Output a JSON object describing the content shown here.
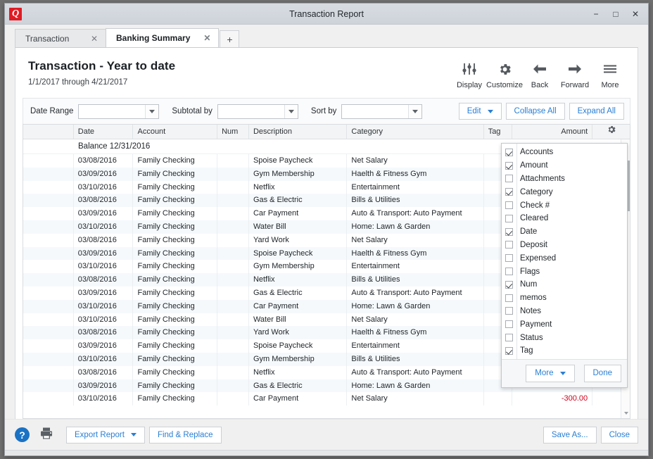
{
  "window": {
    "title": "Transaction Report",
    "app_logo": "Q",
    "minimize": "−",
    "maximize": "□",
    "close": "✕"
  },
  "tabs": [
    {
      "label": "Transaction",
      "close": "✕",
      "active": false
    },
    {
      "label": "Banking Summary",
      "close": "✕",
      "active": true
    }
  ],
  "tab_add_label": "+",
  "report": {
    "title": "Transaction - Year to date",
    "subtitle": "1/1/2017 through 4/21/2017"
  },
  "toolbar": [
    {
      "label": "Display",
      "icon": "sliders-icon"
    },
    {
      "label": "Customize",
      "icon": "gear-icon"
    },
    {
      "label": "Back",
      "icon": "arrow-left-icon"
    },
    {
      "label": "Forward",
      "icon": "arrow-right-icon"
    },
    {
      "label": "More",
      "icon": "hamburger-icon"
    }
  ],
  "filterbar": {
    "date_range_label": "Date Range",
    "date_range_value": "",
    "subtotal_label": "Subtotal by",
    "subtotal_value": "",
    "sort_label": "Sort by",
    "sort_value": "",
    "edit_label": "Edit",
    "collapse_all_label": "Collapse All",
    "expand_all_label": "Expand All"
  },
  "table": {
    "columns": [
      "",
      "Date",
      "Account",
      "Num",
      "Description",
      "Category",
      "Tag",
      "Amount",
      ""
    ],
    "gear_icon": "gear-icon",
    "balance_row_label": "Balance 12/31/2016",
    "rows": [
      {
        "date": "03/08/2016",
        "account": "Family Checking",
        "num": "",
        "description": "Spoise Paycheck",
        "category": "Net Salary",
        "tag": "",
        "amount": ""
      },
      {
        "date": "03/09/2016",
        "account": "Family Checking",
        "num": "",
        "description": "Gym Membership",
        "category": "Haelth & Fitness Gym",
        "tag": "",
        "amount": ""
      },
      {
        "date": "03/10/2016",
        "account": "Family Checking",
        "num": "",
        "description": "Netflix",
        "category": "Entertainment",
        "tag": "",
        "amount": ""
      },
      {
        "date": "03/08/2016",
        "account": "Family Checking",
        "num": "",
        "description": "Gas & Electric",
        "category": "Bills & Utilities",
        "tag": "",
        "amount": ""
      },
      {
        "date": "03/09/2016",
        "account": "Family Checking",
        "num": "",
        "description": "Car Payment",
        "category": "Auto & Transport: Auto Payment",
        "tag": "",
        "amount": ""
      },
      {
        "date": "03/10/2016",
        "account": "Family Checking",
        "num": "",
        "description": "Water Bill",
        "category": "Home: Lawn & Garden",
        "tag": "",
        "amount": ""
      },
      {
        "date": "03/08/2016",
        "account": "Family Checking",
        "num": "",
        "description": "Yard Work",
        "category": "Net Salary",
        "tag": "",
        "amount": ""
      },
      {
        "date": "03/09/2016",
        "account": "Family Checking",
        "num": "",
        "description": "Spoise Paycheck",
        "category": "Haelth & Fitness Gym",
        "tag": "",
        "amount": ""
      },
      {
        "date": "03/10/2016",
        "account": "Family Checking",
        "num": "",
        "description": "Gym Membership",
        "category": "Entertainment",
        "tag": "",
        "amount": ""
      },
      {
        "date": "03/08/2016",
        "account": "Family Checking",
        "num": "",
        "description": "Netflix",
        "category": "Bills & Utilities",
        "tag": "",
        "amount": ""
      },
      {
        "date": "03/09/2016",
        "account": "Family Checking",
        "num": "",
        "description": "Gas & Electric",
        "category": "Auto & Transport: Auto Payment",
        "tag": "",
        "amount": ""
      },
      {
        "date": "03/10/2016",
        "account": "Family Checking",
        "num": "",
        "description": "Car Payment",
        "category": "Home: Lawn & Garden",
        "tag": "",
        "amount": ""
      },
      {
        "date": "03/10/2016",
        "account": "Family Checking",
        "num": "",
        "description": "Water Bill",
        "category": "Net Salary",
        "tag": "",
        "amount": ""
      },
      {
        "date": "03/08/2016",
        "account": "Family Checking",
        "num": "",
        "description": "Yard Work",
        "category": "Haelth & Fitness Gym",
        "tag": "",
        "amount": ""
      },
      {
        "date": "03/09/2016",
        "account": "Family Checking",
        "num": "",
        "description": "Spoise Paycheck",
        "category": "Entertainment",
        "tag": "",
        "amount": ""
      },
      {
        "date": "03/10/2016",
        "account": "Family Checking",
        "num": "",
        "description": "Gym Membership",
        "category": "Bills & Utilities",
        "tag": "",
        "amount": ""
      },
      {
        "date": "03/08/2016",
        "account": "Family Checking",
        "num": "",
        "description": "Netflix",
        "category": "Auto & Transport: Auto Payment",
        "tag": "",
        "amount": ""
      },
      {
        "date": "03/09/2016",
        "account": "Family Checking",
        "num": "",
        "description": "Gas & Electric",
        "category": "Home: Lawn & Garden",
        "tag": "",
        "amount": ""
      },
      {
        "date": "03/10/2016",
        "account": "Family Checking",
        "num": "",
        "description": "Car Payment",
        "category": "Net Salary",
        "tag": "",
        "amount": "-300.00"
      }
    ]
  },
  "column_chooser": {
    "items": [
      {
        "label": "Accounts",
        "checked": true
      },
      {
        "label": "Amount",
        "checked": true
      },
      {
        "label": "Attachments",
        "checked": false
      },
      {
        "label": "Category",
        "checked": true
      },
      {
        "label": "Check #",
        "checked": false
      },
      {
        "label": "Cleared",
        "checked": false
      },
      {
        "label": "Date",
        "checked": true
      },
      {
        "label": "Deposit",
        "checked": false
      },
      {
        "label": "Expensed",
        "checked": false
      },
      {
        "label": "Flags",
        "checked": false
      },
      {
        "label": "Num",
        "checked": true
      },
      {
        "label": "memos",
        "checked": false
      },
      {
        "label": "Notes",
        "checked": false
      },
      {
        "label": "Payment",
        "checked": false
      },
      {
        "label": "Status",
        "checked": false
      },
      {
        "label": "Tag",
        "checked": true
      }
    ],
    "more_label": "More",
    "done_label": "Done"
  },
  "footer": {
    "help_label": "?",
    "print_icon": "printer-icon",
    "export_label": "Export Report",
    "find_replace_label": "Find & Replace",
    "save_as_label": "Save As...",
    "close_label": "Close"
  },
  "colors": {
    "accent_link": "#2a7fd4",
    "negative_amount": "#d0021b",
    "brand_red": "#e01b24",
    "row_stripe": "#f5f9fc"
  }
}
